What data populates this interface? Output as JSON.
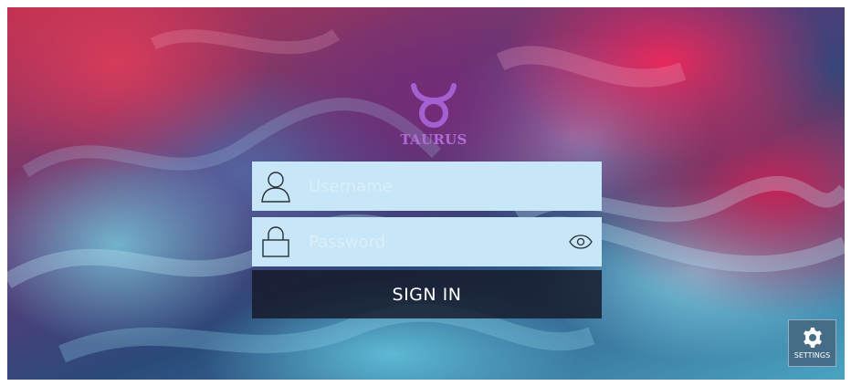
{
  "app": {
    "name": "TAURUS",
    "logo_glyph": "taurus-symbol",
    "brand_color": "#b06bd6"
  },
  "login": {
    "username_placeholder": "Username",
    "password_placeholder": "Password",
    "sign_in_label": "SIGN IN",
    "field_bg": "#c7e6f7",
    "button_bg": "#161828"
  },
  "settings": {
    "label": "SETTINGS",
    "icon": "gear-icon"
  }
}
